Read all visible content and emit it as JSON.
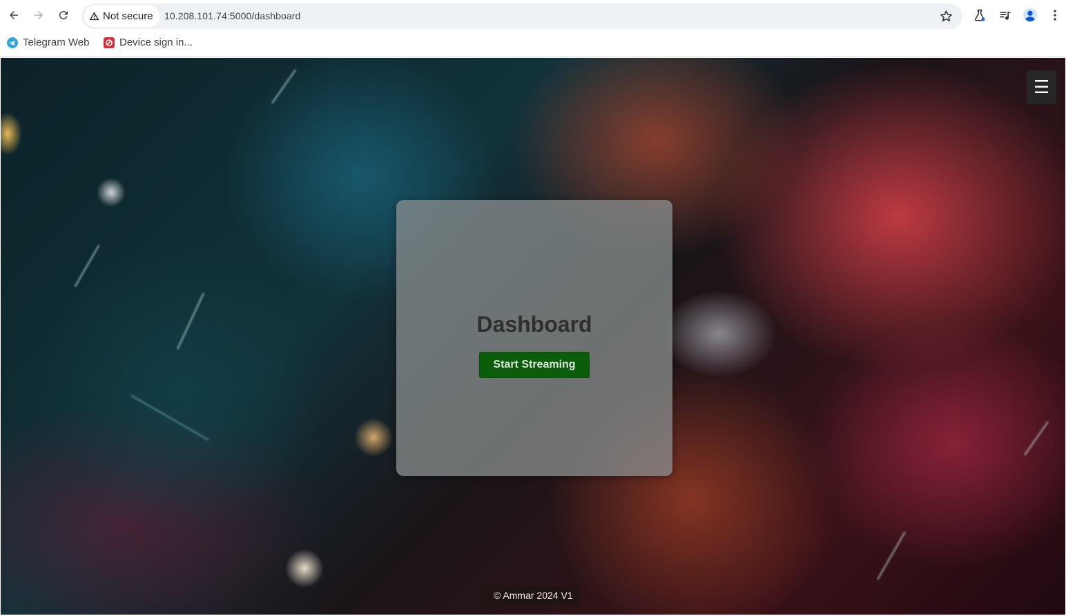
{
  "browser": {
    "security_label": "Not secure",
    "url": "10.208.101.74:5000/dashboard",
    "bookmarks": [
      {
        "label": "Telegram Web",
        "icon": "telegram-icon"
      },
      {
        "label": "Device sign in...",
        "icon": "device-signin-icon"
      }
    ]
  },
  "page": {
    "title": "Dashboard",
    "start_button": "Start Streaming",
    "menu_icon": "☰",
    "footer": "© Ammar 2024 V1"
  },
  "colors": {
    "start_button_bg": "#0b5d0b",
    "card_bg": "rgba(135,140,140,0.78)",
    "menu_bg": "#262626"
  }
}
